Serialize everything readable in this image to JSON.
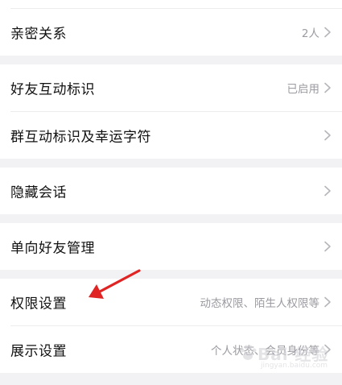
{
  "settings": {
    "rows": [
      {
        "label": "亲密关系",
        "value": "2人"
      },
      {
        "label": "好友互动标识",
        "value": "已启用"
      },
      {
        "label": "群互动标识及幸运字符",
        "value": ""
      },
      {
        "label": "隐藏会话",
        "value": ""
      },
      {
        "label": "单向好友管理",
        "value": ""
      },
      {
        "label": "权限设置",
        "value": "动态权限、陌生人权限等"
      },
      {
        "label": "展示设置",
        "value": "个人状态、会员身份等"
      }
    ]
  },
  "annotation": {
    "arrow_color": "#e02424"
  },
  "watermark": {
    "text": "Bai 经验",
    "sub": "jingyan.baidu.com"
  },
  "colors": {
    "background": "#f2f2f4",
    "card": "#ffffff",
    "label": "#111111",
    "value": "#9b9ba1",
    "chevron": "#b5b5ba"
  }
}
